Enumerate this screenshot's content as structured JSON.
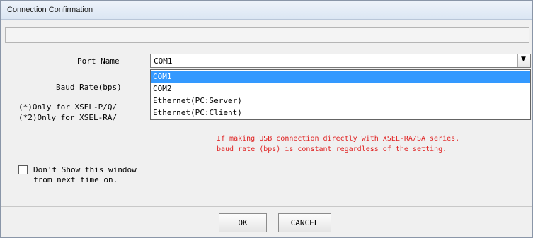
{
  "window": {
    "title": "Connection Confirmation"
  },
  "status_text": "",
  "port": {
    "label": "Port Name",
    "value": "COM1",
    "options": [
      "COM1",
      "COM2",
      "Ethernet(PC:Server)",
      "Ethernet(PC:Client)"
    ],
    "selected_index": 0
  },
  "baud": {
    "label": "Baud Rate(bps)"
  },
  "notes": {
    "note1": "(*)Only for XSEL-P/Q/",
    "note2": "(*2)Only for XSEL-RA/"
  },
  "usb_note": {
    "line1": "If making USB connection directly with XSEL-RA/SA series,",
    "line2": "baud rate (bps) is constant regardless of the setting."
  },
  "dont_show": {
    "line1": "Don't Show this window",
    "line2": "from next time on.",
    "checked": false
  },
  "buttons": {
    "ok": "OK",
    "cancel": "CANCEL"
  },
  "colors": {
    "note_red": "#e02020",
    "selection": "#3399ff"
  }
}
